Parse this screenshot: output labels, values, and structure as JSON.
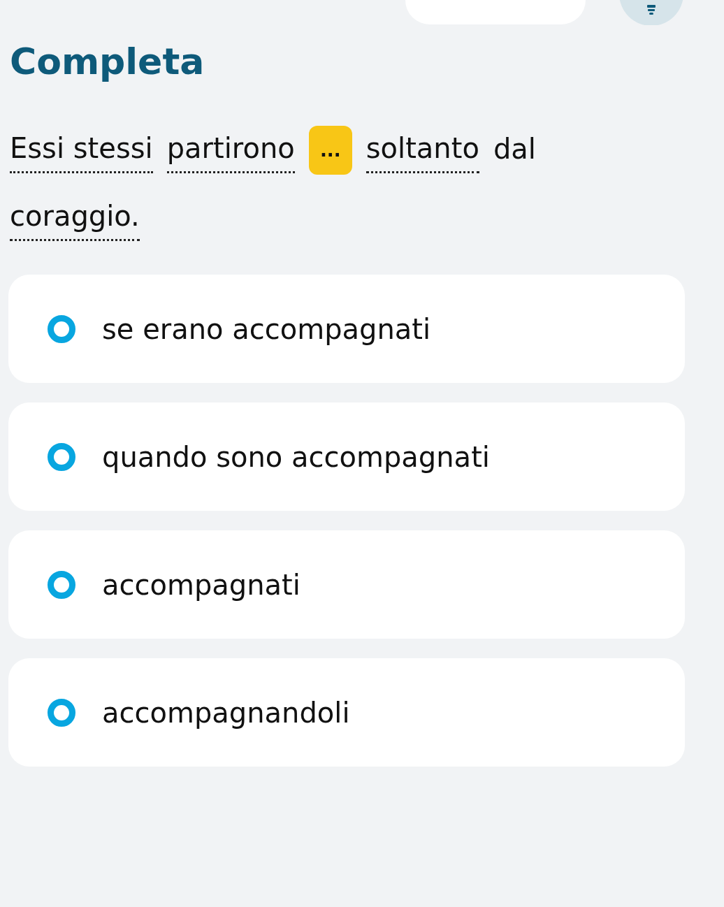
{
  "title": "Completa",
  "sentence": [
    {
      "kind": "word",
      "text": "Essi stessi",
      "underlined": true
    },
    {
      "kind": "word",
      "text": "partirono",
      "underlined": true
    },
    {
      "kind": "blank",
      "text": "..."
    },
    {
      "kind": "word",
      "text": "soltanto",
      "underlined": true
    },
    {
      "kind": "word",
      "text": "dal",
      "underlined": false
    },
    {
      "kind": "word",
      "text": "coraggio.",
      "underlined": true
    }
  ],
  "options": [
    {
      "label": "se erano accompagnati",
      "selected": false
    },
    {
      "label": "quando sono accompagnati",
      "selected": false
    },
    {
      "label": "accompagnati",
      "selected": false
    },
    {
      "label": "accompagnandoli",
      "selected": false
    }
  ]
}
